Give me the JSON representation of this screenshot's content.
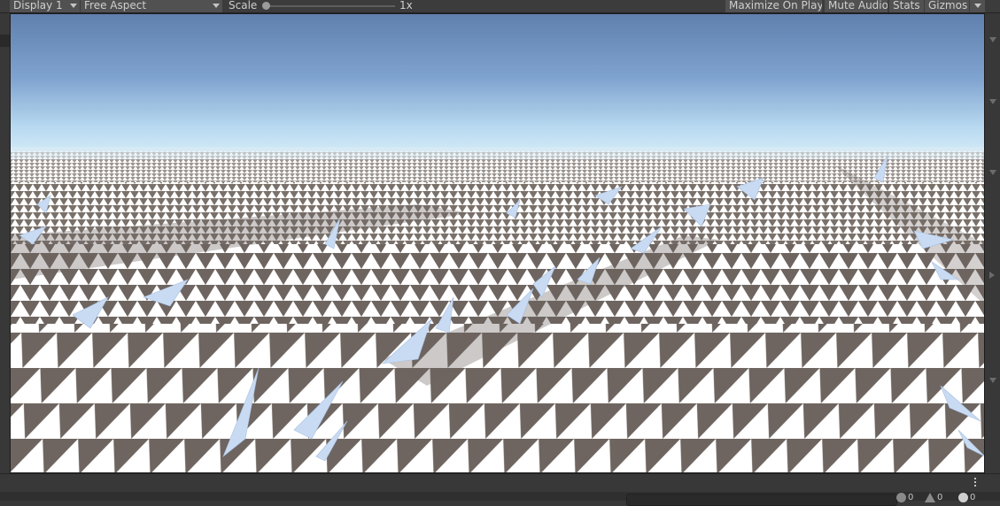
{
  "toolbar": {
    "display_label": "Display 1",
    "aspect_label": "Free Aspect",
    "scale_label": "Scale",
    "scale_value": "1x",
    "maximize_label": "Maximize On Play",
    "mute_label": "Mute Audio",
    "stats_label": "Stats",
    "gizmos_label": "Gizmos"
  },
  "viewport": {
    "sky_top": "#6080ae",
    "sky_horizon": "#d6ecf8",
    "ground_dark": "#6e6560",
    "ground_light": "#ffffff",
    "spike_tint": "#c9dbf3"
  },
  "status": {
    "console_value": "",
    "log_count": "0",
    "warning_count": "0",
    "error_count": "0"
  }
}
